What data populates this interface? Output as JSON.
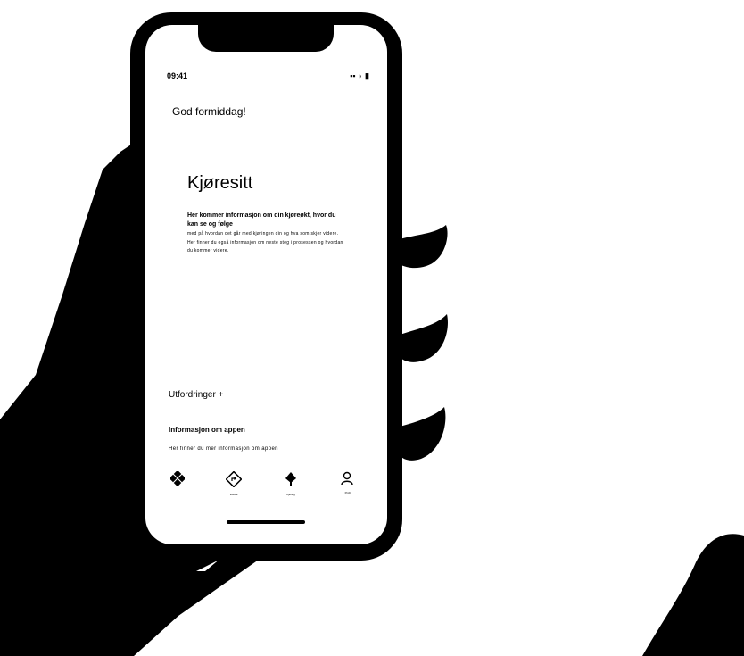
{
  "status_bar": {
    "time": "09:41",
    "indicators": "▪▪ ◗ ▮"
  },
  "greeting": "God formiddag!",
  "card": {
    "title": "Kjøresitt",
    "lead": "Her kommer informasjon om din kjøreøkt, hvor du kan se og følge",
    "body": "med på hvordan det går med kjøringen din og hva som skjer videre. Her finner du også informasjon om neste steg i prosessen og hvordan du kommer videre."
  },
  "section": {
    "title": "Utfordringer +",
    "heading": "Informasjon om appen",
    "text": "Her finner du mer informasjon om appen"
  },
  "tabbar": {
    "tabs": [
      {
        "icon": "apps-icon",
        "label": ""
      },
      {
        "icon": "directions-icon",
        "label": "Veibok"
      },
      {
        "icon": "navigation-icon",
        "label": "Kjøring"
      },
      {
        "icon": "profile-icon",
        "label": "Profil"
      }
    ]
  }
}
